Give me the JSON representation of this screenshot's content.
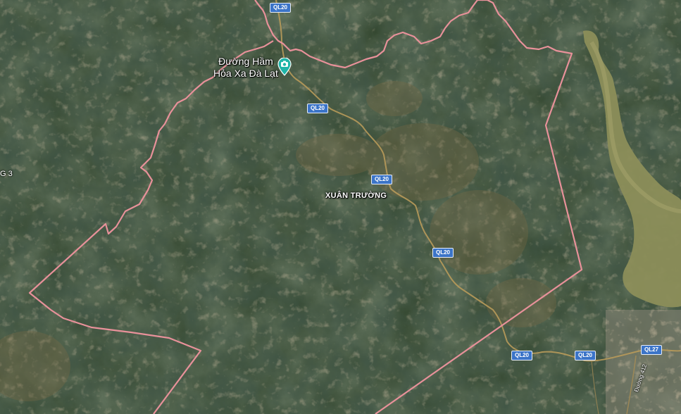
{
  "map": {
    "view": "satellite",
    "colors": {
      "boundary": "#e8919a",
      "road": "#b89a5a",
      "shield": "#3b74c8",
      "poi_pin": "#1fb5a8",
      "water": "#9a9a62"
    },
    "poi": {
      "line1": "Đường Hầm",
      "line2": "Hỏa Xa Đà Lạt",
      "icon": "camera-pin-icon"
    },
    "place_label": "XUÂN TRƯỜNG",
    "edge_label": "G 3",
    "small_road_label": "Đường 412",
    "shields": [
      {
        "id": "ql20-a",
        "text": "QL20"
      },
      {
        "id": "ql20-b",
        "text": "QL20"
      },
      {
        "id": "ql20-c",
        "text": "QL20"
      },
      {
        "id": "ql20-d",
        "text": "QL20"
      },
      {
        "id": "ql20-e",
        "text": "QL20"
      },
      {
        "id": "ql20-f",
        "text": "QL20"
      },
      {
        "id": "ql27",
        "text": "QL27"
      }
    ]
  }
}
